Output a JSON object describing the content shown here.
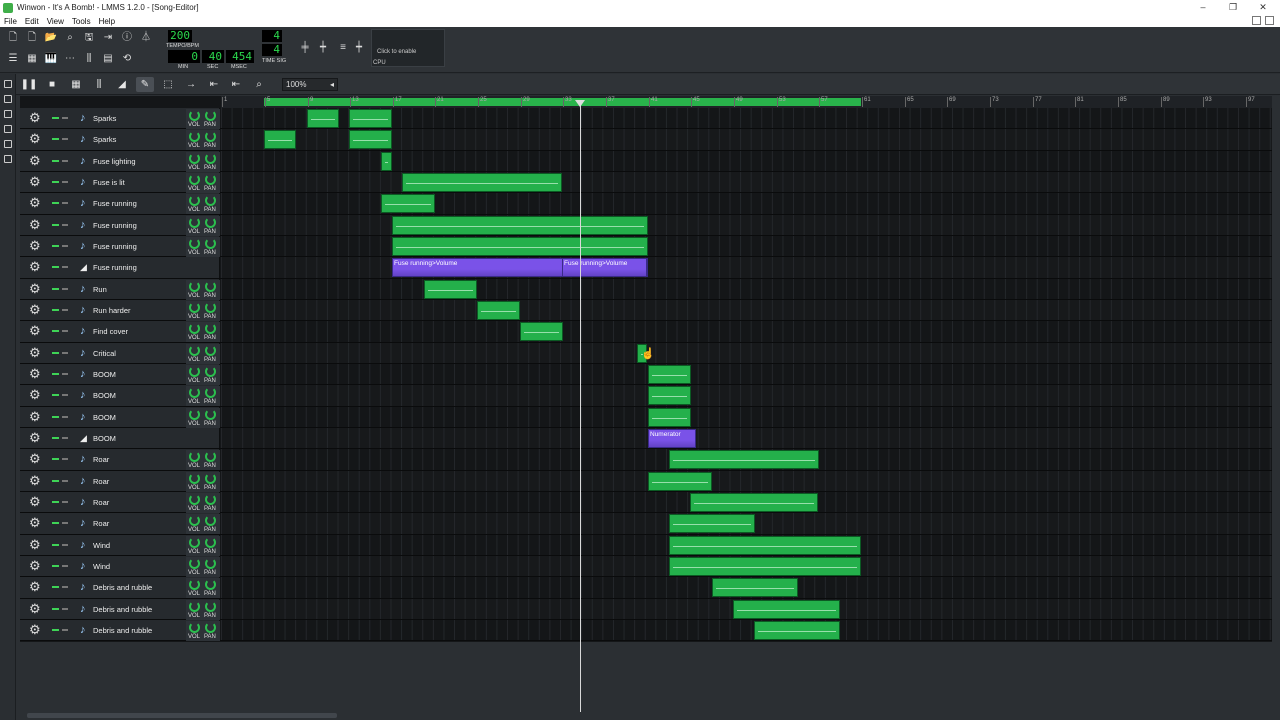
{
  "window": {
    "title": "Winwon - It's A Bomb! - LMMS 1.2.0 - [Song-Editor]",
    "minimize": "–",
    "restore": "❐",
    "close": "✕"
  },
  "menu": [
    "File",
    "Edit",
    "View",
    "Tools",
    "Help"
  ],
  "transport": {
    "tempo": "200",
    "tempo_label": "TEMPO/BPM",
    "min": "0",
    "sec": "40",
    "msec": "454",
    "min_label": "MIN",
    "sec_label": "SEC",
    "msec_label": "MSEC",
    "timesig_num": "4",
    "timesig_den": "4",
    "timesig_label": "TIME SIG",
    "cpu_hint": "Click to enable",
    "cpu_label": "CPU"
  },
  "song_editor": {
    "zoom": "100%"
  },
  "ruler": {
    "labels": [
      "1",
      "5",
      "9",
      "13",
      "17",
      "21",
      "25",
      "29",
      "33",
      "37",
      "41",
      "45",
      "49",
      "53",
      "57",
      "61",
      "65",
      "69",
      "73",
      "77",
      "81",
      "85",
      "89",
      "93",
      "97"
    ]
  },
  "tracks": [
    {
      "name": "Sparks",
      "type": "instrument"
    },
    {
      "name": "Sparks",
      "type": "instrument"
    },
    {
      "name": "Fuse lighting",
      "type": "instrument"
    },
    {
      "name": "Fuse is lit",
      "type": "instrument"
    },
    {
      "name": "Fuse running",
      "type": "instrument"
    },
    {
      "name": "Fuse running",
      "type": "instrument"
    },
    {
      "name": "Fuse running",
      "type": "instrument"
    },
    {
      "name": "Fuse running",
      "type": "automation",
      "clips_text": [
        "Fuse running>Volume",
        "Fuse running>Volume"
      ]
    },
    {
      "name": "Run",
      "type": "instrument"
    },
    {
      "name": "Run harder",
      "type": "instrument"
    },
    {
      "name": "Find cover",
      "type": "instrument"
    },
    {
      "name": "Critical",
      "type": "instrument"
    },
    {
      "name": "BOOM",
      "type": "instrument"
    },
    {
      "name": "BOOM",
      "type": "instrument"
    },
    {
      "name": "BOOM",
      "type": "instrument"
    },
    {
      "name": "BOOM",
      "type": "automation",
      "clips_text": [
        "Numerator"
      ]
    },
    {
      "name": "Roar",
      "type": "instrument"
    },
    {
      "name": "Roar",
      "type": "instrument"
    },
    {
      "name": "Roar",
      "type": "instrument"
    },
    {
      "name": "Roar",
      "type": "instrument"
    },
    {
      "name": "Wind",
      "type": "instrument"
    },
    {
      "name": "Wind",
      "type": "instrument"
    },
    {
      "name": "Debris and rubble",
      "type": "instrument"
    },
    {
      "name": "Debris and rubble",
      "type": "instrument"
    },
    {
      "name": "Debris and rubble",
      "type": "instrument"
    }
  ],
  "knob_labels": {
    "vol": "VOL",
    "pan": "PAN"
  },
  "icons": {
    "gear": "gear-icon",
    "mute": "mute-led-icon",
    "solo": "solo-led-icon",
    "instrument": "note-icon",
    "automation": "automation-icon"
  }
}
